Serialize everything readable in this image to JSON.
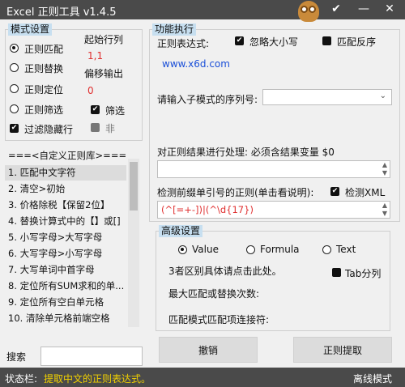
{
  "app": {
    "title": "Excel 正则工具 v1.4.5"
  },
  "titlebar": {
    "minimize_icon": "minimize-icon",
    "check_icon": "check-icon",
    "close_icon": "close-icon",
    "check_glyph": "✔",
    "minimize_glyph": "—",
    "close_glyph": "✕"
  },
  "mode": {
    "legend": "模式设置",
    "options": [
      {
        "label": "正则匹配",
        "selected": true
      },
      {
        "label": "正则替换",
        "selected": false
      },
      {
        "label": "正则定位",
        "selected": false
      },
      {
        "label": "正则筛选",
        "selected": false
      }
    ],
    "filter_hidden": {
      "label": "过滤隐藏行",
      "checked": true
    },
    "start_col_label": "起始行列",
    "start_col_value": "1,1",
    "offset_label": "偏移输出",
    "offset_value": "0",
    "screen": {
      "label": "筛选",
      "checked": true
    },
    "not": {
      "label": "非",
      "checked": false
    }
  },
  "library": {
    "header": "===<自定义正则库>===",
    "items": [
      "1. 匹配中文字符",
      "2. 清空>初始",
      "3. 价格除税【保留2位】",
      "4. 替换计算式中的【】或[]",
      "5. 小写字母>大写字母",
      "6. 大写字母>小写字母",
      "7. 大写单词中首字母",
      "8. 定位所有SUM求和的单...",
      "9. 定位所有空白单元格",
      "10. 清除单元格前端空格"
    ],
    "selected_index": 0,
    "search_label": "搜索",
    "search_value": ""
  },
  "func": {
    "legend": "功能执行",
    "regex_label": "正则表达式:",
    "ignore_case": {
      "label": "忽略大小写",
      "checked": true
    },
    "invert": {
      "label": "匹配反序",
      "checked": false
    },
    "regex_value": "www.x6d.com",
    "submatch_label": "请输入子模式的序列号:",
    "submatch_value": "",
    "process_label": "对正则结果进行处理: 必须含结果变量 $0",
    "process_value": "",
    "prefix_label": "检测前缀单引号的正则(单击看说明):",
    "check_xml": {
      "label": "检测XML",
      "checked": true
    },
    "prefix_value": "(^[=+-])|(^\\d{17})"
  },
  "advanced": {
    "legend": "高级设置",
    "options": [
      {
        "label": "Value",
        "selected": true
      },
      {
        "label": "Formula",
        "selected": false
      },
      {
        "label": "Text",
        "selected": false
      }
    ],
    "hint": "3者区别具体请点击此处。",
    "tab_split": {
      "label": "Tab分列",
      "checked": false
    },
    "max_match_label": "最大匹配或替换次数:",
    "join_label": "匹配模式匹配项连接符:"
  },
  "buttons": {
    "undo": "撤销",
    "extract": "正则提取"
  },
  "status": {
    "label": "状态栏:",
    "message": "提取中文的正则表达式。",
    "mode": "离线模式"
  },
  "colors": {
    "titlebar": "#4a4a4a",
    "legend_bg": "#c7dff0",
    "status_msg": "#f0d000",
    "accent_red": "#e03030",
    "link_blue": "#1a4fd8"
  }
}
